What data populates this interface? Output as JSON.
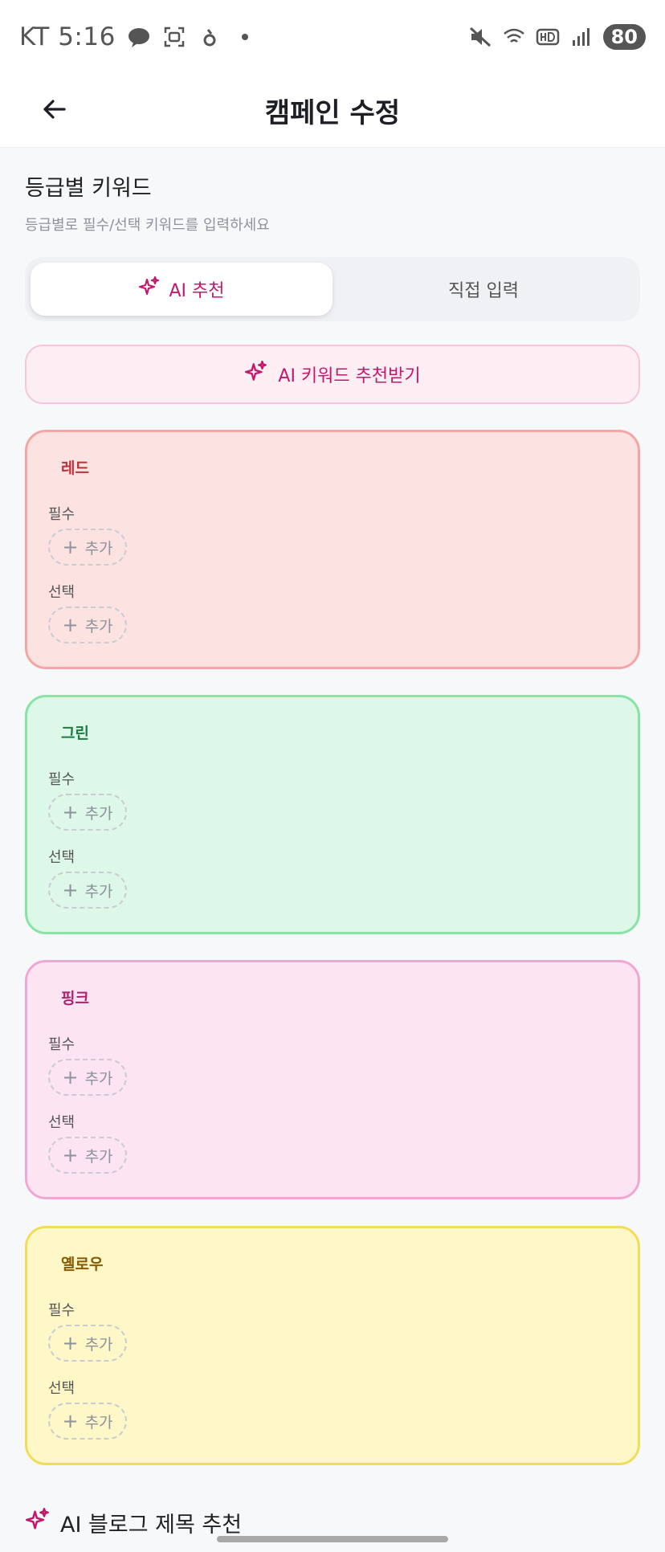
{
  "status_bar": {
    "time": "KT 5:16",
    "battery": "80",
    "colors": {
      "text": "#555555"
    }
  },
  "header": {
    "title": "캠페인 수정",
    "back_icon": "arrow-left-icon"
  },
  "section": {
    "title": "등급별 키워드",
    "subtitle": "등급별로 필수/선택 키워드를 입력하세요"
  },
  "tabs": [
    {
      "label": "AI 추천",
      "active": true,
      "icon": "sparkle-icon"
    },
    {
      "label": "직접 입력",
      "active": false
    }
  ],
  "ai_button": {
    "label": "AI 키워드 추천받기",
    "icon": "sparkle-icon"
  },
  "grades": [
    {
      "name": "레드",
      "required_label": "필수",
      "optional_label": "선택",
      "add_label": "추가",
      "accent": "#b8323a"
    },
    {
      "name": "그린",
      "required_label": "필수",
      "optional_label": "선택",
      "add_label": "추가",
      "accent": "#1f7a44"
    },
    {
      "name": "핑크",
      "required_label": "필수",
      "optional_label": "선택",
      "add_label": "추가",
      "accent": "#b0216d"
    },
    {
      "name": "옐로우",
      "required_label": "필수",
      "optional_label": "선택",
      "add_label": "추가",
      "accent": "#8a5a00"
    }
  ],
  "blog": {
    "title": "AI 블로그 제목 추천",
    "icon": "sparkle-icon"
  },
  "colors": {
    "accent": "#c2186b"
  }
}
